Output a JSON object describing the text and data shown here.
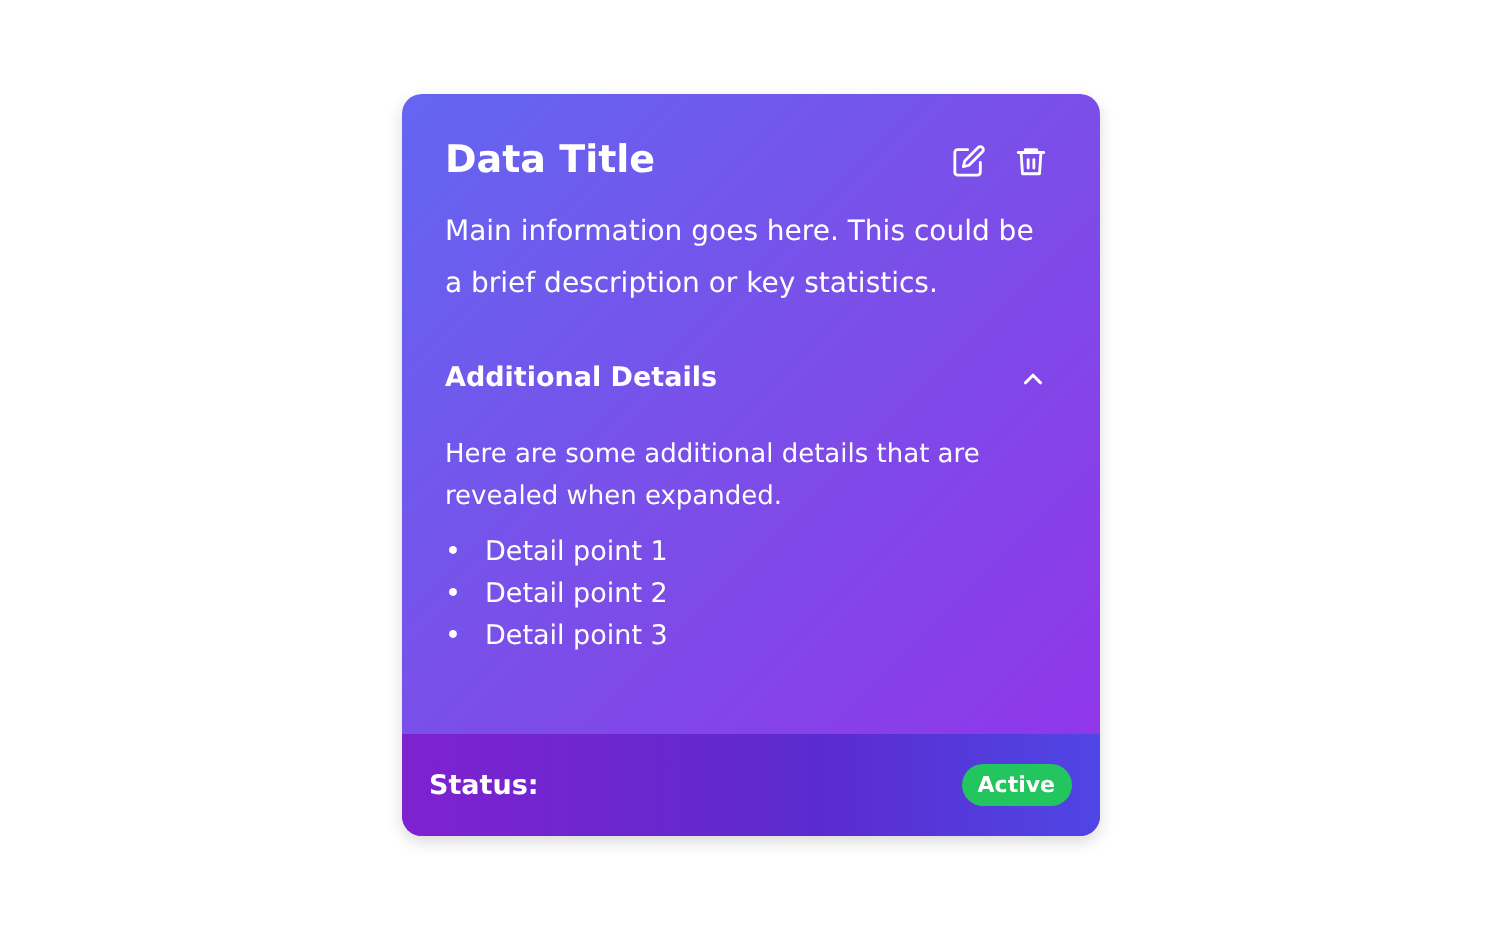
{
  "card": {
    "title": "Data Title",
    "description": "Main information goes here. This could be a brief description or key statistics.",
    "details": {
      "heading": "Additional Details",
      "expanded": true,
      "text": "Here are some additional details that are revealed when expanded.",
      "points": [
        {
          "bullet": "•",
          "text": "Detail point 1"
        },
        {
          "bullet": "•",
          "text": "Detail point 2"
        },
        {
          "bullet": "•",
          "text": "Detail point 3"
        }
      ]
    },
    "footer": {
      "label": "Status:",
      "badge": "Active",
      "color": "#22c55e"
    }
  }
}
